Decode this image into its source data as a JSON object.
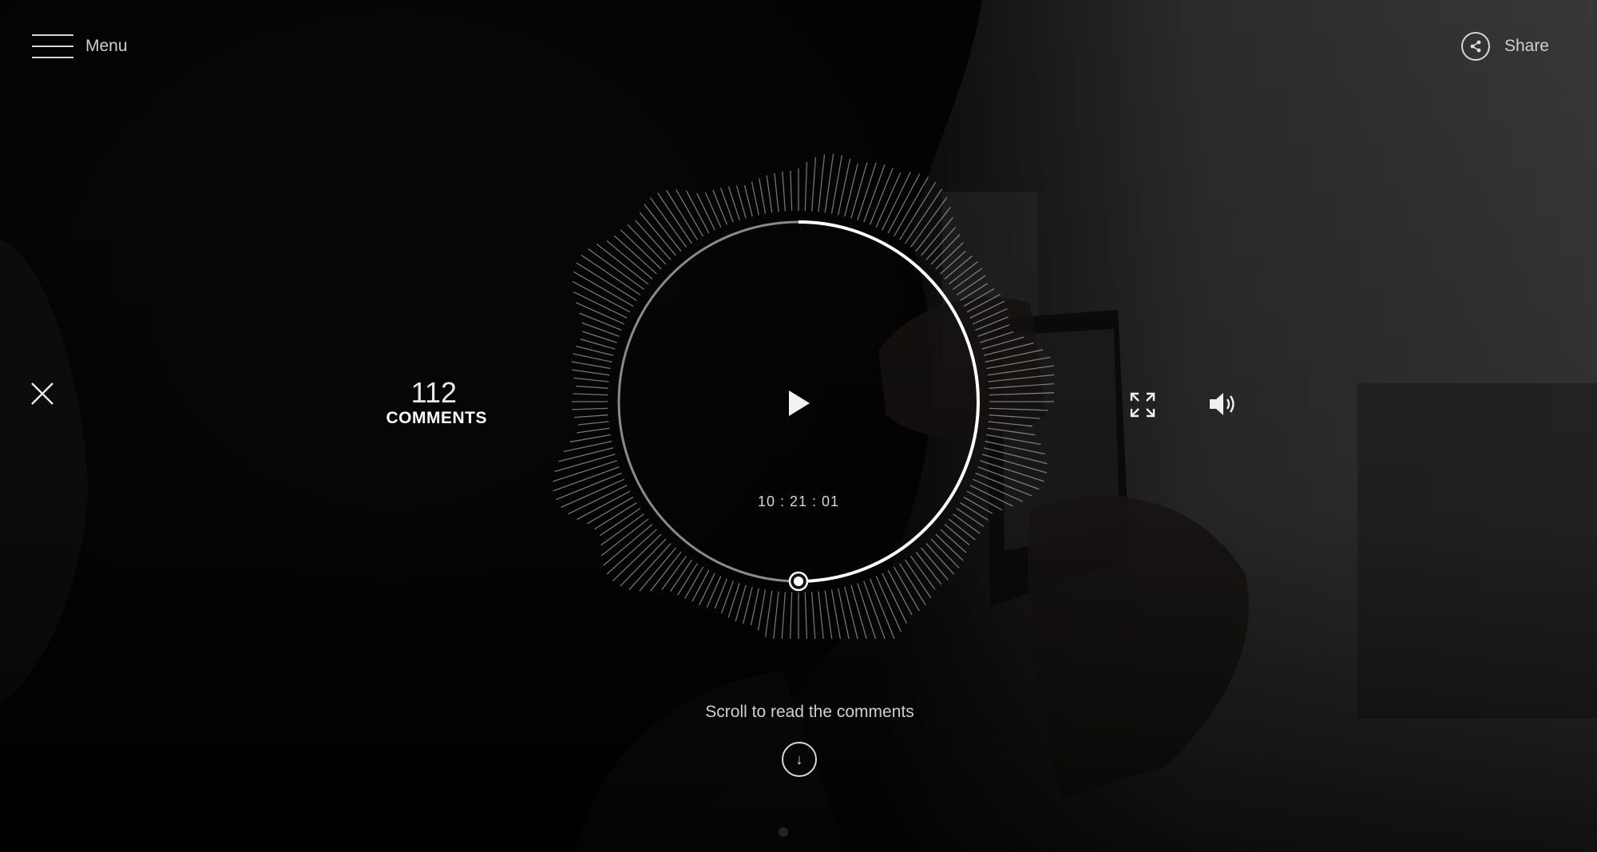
{
  "nav": {
    "menu_label": "Menu",
    "share_label": "Share"
  },
  "comments": {
    "count": "112",
    "label": "COMMENTS"
  },
  "player": {
    "timecode": "10 : 21 : 01",
    "progress_fraction": 0.5
  },
  "scroll": {
    "hint": "Scroll to read the comments",
    "arrow": "↓"
  },
  "icons": {
    "menu": "hamburger-icon",
    "share": "share-icon",
    "close": "close-icon",
    "play": "play-icon",
    "fullscreen": "fullscreen-icon",
    "volume": "volume-icon",
    "scroll": "arrow-down-icon"
  },
  "colors": {
    "background": "#0a0a0a",
    "foreground": "#ffffff",
    "muted": "#cfcfcf"
  }
}
